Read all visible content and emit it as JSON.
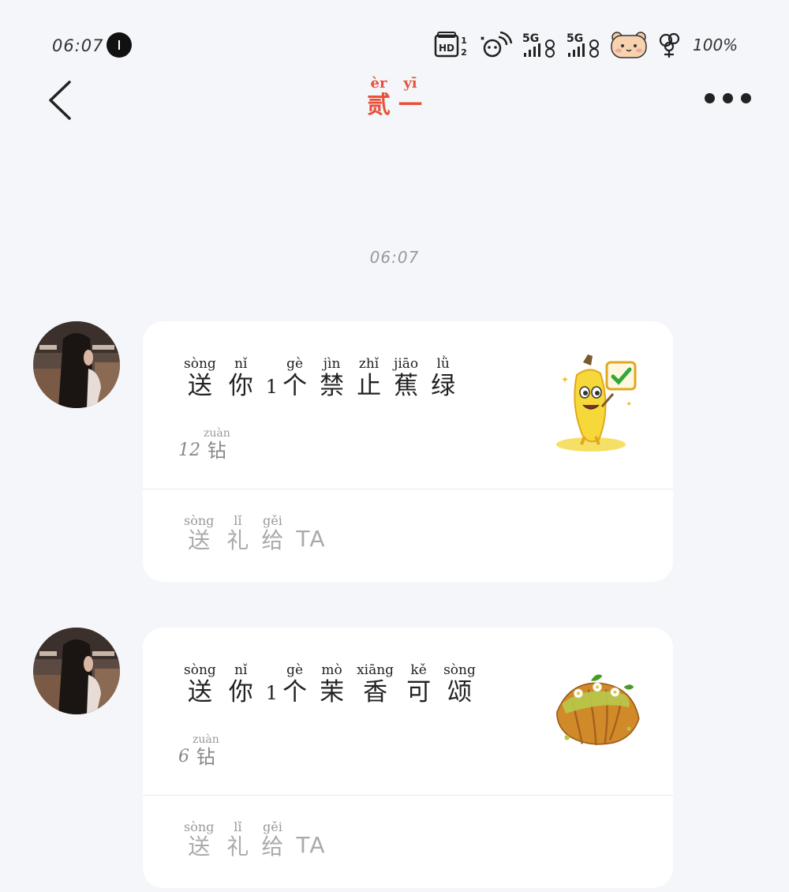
{
  "status_bar": {
    "time": "06:07",
    "battery": "100%",
    "icons": [
      "hd-icon",
      "wifi-icon",
      "signal-5g-icon",
      "signal-5g-icon",
      "bear-sticker-icon",
      "flower-icon"
    ],
    "hd_label": "HD",
    "hd_sub": "1 2",
    "net1": "5G",
    "net2": "5G"
  },
  "header": {
    "title_pinyin": [
      "èr",
      "yī"
    ],
    "title_chars": [
      "贰",
      "一"
    ],
    "title_color": "#e8503a"
  },
  "chat": {
    "timestamp": "06:07",
    "messages": [
      {
        "headline": [
          {
            "py": "sòng",
            "hz": "送"
          },
          {
            "py": "nǐ",
            "hz": "你"
          },
          {
            "num": "1"
          },
          {
            "py": "gè",
            "hz": "个"
          },
          {
            "py": "jìn",
            "hz": "禁"
          },
          {
            "py": "zhǐ",
            "hz": "止"
          },
          {
            "py": "jiāo",
            "hz": "蕉"
          },
          {
            "py": "lǜ",
            "hz": "绿"
          }
        ],
        "price_num": "12",
        "price_unit_py": "zuàn",
        "price_unit_hz": "钻",
        "gift_icon": "banana-gift-icon",
        "cta": [
          {
            "py": "sòng",
            "hz": "送"
          },
          {
            "py": "lǐ",
            "hz": "礼"
          },
          {
            "py": "gěi",
            "hz": "给"
          }
        ],
        "cta_suffix": "TA"
      },
      {
        "headline": [
          {
            "py": "sòng",
            "hz": "送"
          },
          {
            "py": "nǐ",
            "hz": "你"
          },
          {
            "num": "1"
          },
          {
            "py": "gè",
            "hz": "个"
          },
          {
            "py": "mò",
            "hz": "茉"
          },
          {
            "py": "xiāng",
            "hz": "香"
          },
          {
            "py": "kě",
            "hz": "可"
          },
          {
            "py": "sòng",
            "hz": "颂"
          }
        ],
        "price_num": "6",
        "price_unit_py": "zuàn",
        "price_unit_hz": "钻",
        "gift_icon": "croissant-gift-icon",
        "cta": [
          {
            "py": "sòng",
            "hz": "送"
          },
          {
            "py": "lǐ",
            "hz": "礼"
          },
          {
            "py": "gěi",
            "hz": "给"
          }
        ],
        "cta_suffix": "TA"
      }
    ]
  }
}
